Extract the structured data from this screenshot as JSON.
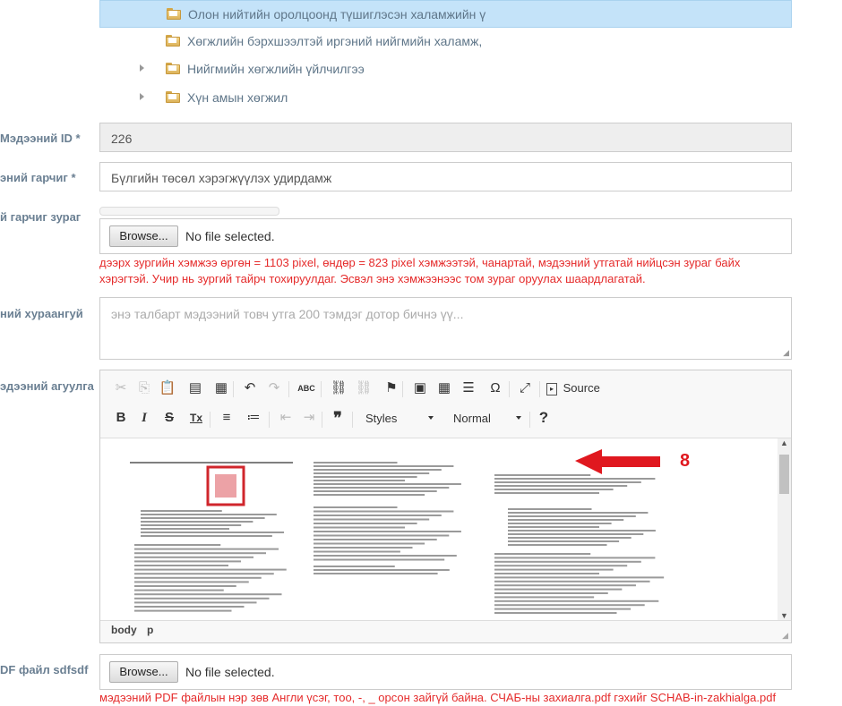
{
  "tree": {
    "items": [
      {
        "label": "Олон нийтийн оролцоонд түшиглэсэн халамжийн ү",
        "selected": true,
        "expandable": false
      },
      {
        "label": "Хөгжлийн бэрхшээлтэй иргэний нийгмийн халамж,",
        "selected": false,
        "expandable": false
      },
      {
        "label": "Нийгмийн хөгжлийн үйлчилгээ",
        "selected": false,
        "expandable": true
      },
      {
        "label": "Хүн амын хөгжил",
        "selected": false,
        "expandable": true
      }
    ]
  },
  "fields": {
    "id": {
      "label": "Мэдээний ID *",
      "value": "226"
    },
    "title": {
      "label": "эний гарчиг *",
      "value": "Бүлгийн төсөл хэрэгжүүлэх удирдамж"
    },
    "image": {
      "label": "й гарчиг зураг",
      "browse_label": "Browse...",
      "file_status": "No file selected.",
      "help": "дээрх зургийн хэмжээ өргөн = 1103 pixel, өндөр = 823 pixel хэмжээтэй, чанартай, мэдээний утгатай нийцсэн зураг байх хэрэгтэй. Учир нь зургий тайрч тохируулдаг. Эсвэл энэ хэмжээнээс том зураг оруулах шаардлагатай."
    },
    "summary": {
      "label": "ний хураангуй",
      "placeholder": "энэ талбарт мэдээний товч утга 200 тэмдэг дотор бичнэ үү..."
    },
    "content": {
      "label": "эдээний агуулга"
    },
    "pdf": {
      "label": "DF файл sdfsdf",
      "browse_label": "Browse...",
      "file_status": "No file selected.",
      "help": "мэдээний PDF файлын нэр зөв Англи үсэг, тоо, -, _ орсон зайгүй байна. СЧАБ-ны захиалга.pdf гэхийг SCHAB-in-zakhialga.pdf"
    }
  },
  "editor": {
    "toolbar_row1": [
      {
        "name": "cut-icon",
        "glyph": "✂",
        "disabled": true
      },
      {
        "name": "copy-icon",
        "glyph": "⎘",
        "disabled": true
      },
      {
        "name": "paste-icon",
        "glyph": "📋",
        "disabled": false
      },
      {
        "name": "paste-text-icon",
        "glyph": "▤",
        "disabled": false
      },
      {
        "name": "paste-word-icon",
        "glyph": "▦",
        "disabled": false
      },
      {
        "name": "undo-icon",
        "glyph": "↶",
        "disabled": false
      },
      {
        "name": "redo-icon",
        "glyph": "↷",
        "disabled": true
      },
      {
        "name": "spellcheck-icon",
        "glyph": "ABC",
        "disabled": false
      },
      {
        "name": "link-icon",
        "glyph": "⛓",
        "disabled": false
      },
      {
        "name": "unlink-icon",
        "glyph": "⛓",
        "disabled": true
      },
      {
        "name": "anchor-flag-icon",
        "glyph": "⚑",
        "disabled": false
      },
      {
        "name": "image-icon",
        "glyph": "▣",
        "disabled": false
      },
      {
        "name": "table-icon",
        "glyph": "▦",
        "disabled": false
      },
      {
        "name": "horizontal-rule-icon",
        "glyph": "☰",
        "disabled": false
      },
      {
        "name": "special-char-icon",
        "glyph": "Ω",
        "disabled": false
      },
      {
        "name": "maximize-icon",
        "glyph": "⤢",
        "disabled": false
      }
    ],
    "source_label": "Source",
    "toolbar_row2": [
      {
        "name": "bold-icon",
        "glyph": "B"
      },
      {
        "name": "italic-icon",
        "glyph": "I"
      },
      {
        "name": "strike-icon",
        "glyph": "S"
      },
      {
        "name": "remove-format-icon",
        "glyph": "Tx"
      },
      {
        "name": "numbered-list-icon",
        "glyph": "≡"
      },
      {
        "name": "bulleted-list-icon",
        "glyph": "≔"
      },
      {
        "name": "outdent-icon",
        "glyph": "⇤"
      },
      {
        "name": "indent-icon",
        "glyph": "⇥"
      },
      {
        "name": "blockquote-icon",
        "glyph": "❞"
      }
    ],
    "styles_label": "Styles",
    "format_label": "Normal",
    "help_glyph": "?",
    "annotation_number": "8",
    "path": [
      "body",
      "p"
    ],
    "colors": {
      "arrow": "#e0181f",
      "stamp": "#d0262c"
    }
  }
}
